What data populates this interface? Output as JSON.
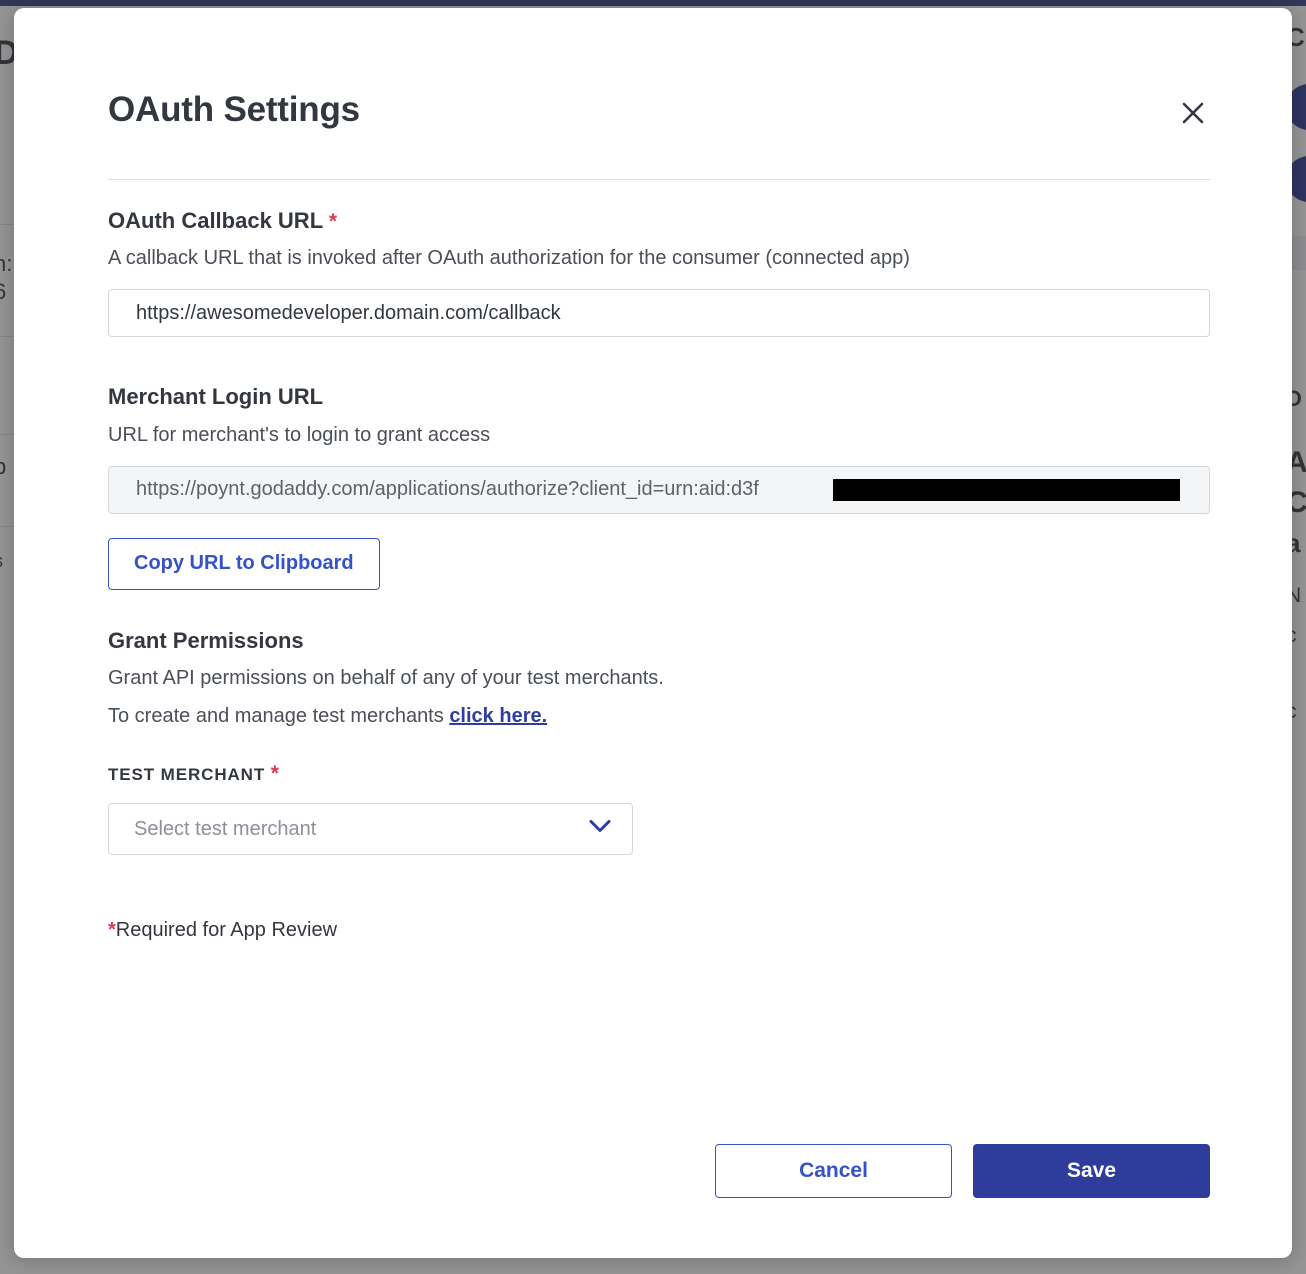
{
  "background": {
    "topbar_color": "#2f3d87",
    "left_fragments": [
      "D",
      "n:",
      "6",
      "b",
      "s"
    ],
    "right_fragments": [
      "C",
      "D",
      "A",
      "C",
      "a",
      "N",
      "c",
      "t",
      "c"
    ]
  },
  "modal": {
    "title": "OAuth Settings",
    "close_icon": "close-icon",
    "required_star": "*",
    "required_note_prefix": "*",
    "required_note": "Required for App Review",
    "accent_blue": "#3453c8",
    "primary_blue": "#2e3c9b",
    "required_red": "#e0394f",
    "fields": {
      "callback": {
        "label": "OAuth Callback URL",
        "required": true,
        "help": "A callback URL that is invoked after OAuth authorization for the consumer (connected app)",
        "value": "https://awesomedeveloper.domain.com/callback",
        "placeholder": "https://"
      },
      "merchant_login": {
        "label": "Merchant Login URL",
        "required": false,
        "help": "URL for merchant's to login to grant access",
        "value": "https://poynt.godaddy.com/applications/authorize?client_id=urn:aid:d3f",
        "redacted": true,
        "copy_button_label": "Copy URL to Clipboard"
      },
      "grant_permissions": {
        "label": "Grant Permissions",
        "help": "Grant API permissions on behalf of any of your test merchants.",
        "link_sentence_prefix": "To create and manage test merchants ",
        "link_label": "click here.",
        "merchant_select": {
          "label": "TEST MERCHANT",
          "required": true,
          "placeholder": "Select test merchant",
          "value": "",
          "chevron_icon": "chevron-down-icon"
        }
      }
    },
    "footer": {
      "cancel_label": "Cancel",
      "save_label": "Save"
    }
  }
}
